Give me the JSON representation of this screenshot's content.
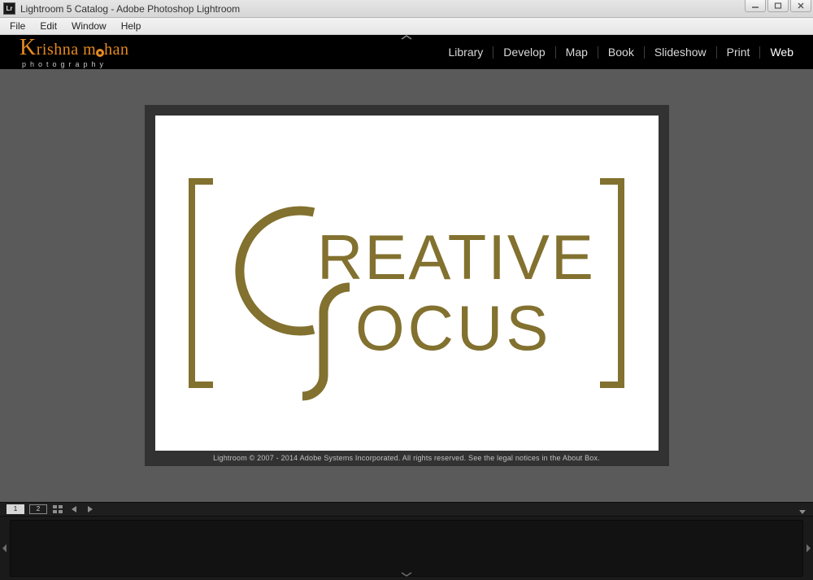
{
  "window": {
    "title": "Lightroom 5 Catalog - Adobe Photoshop Lightroom",
    "app_icon_text": "Lr"
  },
  "menu": {
    "items": [
      "File",
      "Edit",
      "Window",
      "Help"
    ]
  },
  "identity_plate": {
    "line1_part1": "K",
    "line1_part2": "rishna m",
    "line1_part3": "han",
    "line2": "photography"
  },
  "modules": [
    {
      "label": "Library",
      "active": false
    },
    {
      "label": "Develop",
      "active": false
    },
    {
      "label": "Map",
      "active": false
    },
    {
      "label": "Book",
      "active": false
    },
    {
      "label": "Slideshow",
      "active": false
    },
    {
      "label": "Print",
      "active": false
    },
    {
      "label": "Web",
      "active": true
    }
  ],
  "splash": {
    "logo_word1": "REATIVE",
    "logo_word2": "OCUS",
    "footer": "Lightroom © 2007 - 2014 Adobe Systems Incorporated.  All rights reserved.  See the legal notices in the About Box."
  },
  "toolbar": {
    "page_current": "1",
    "page_other": "2"
  }
}
